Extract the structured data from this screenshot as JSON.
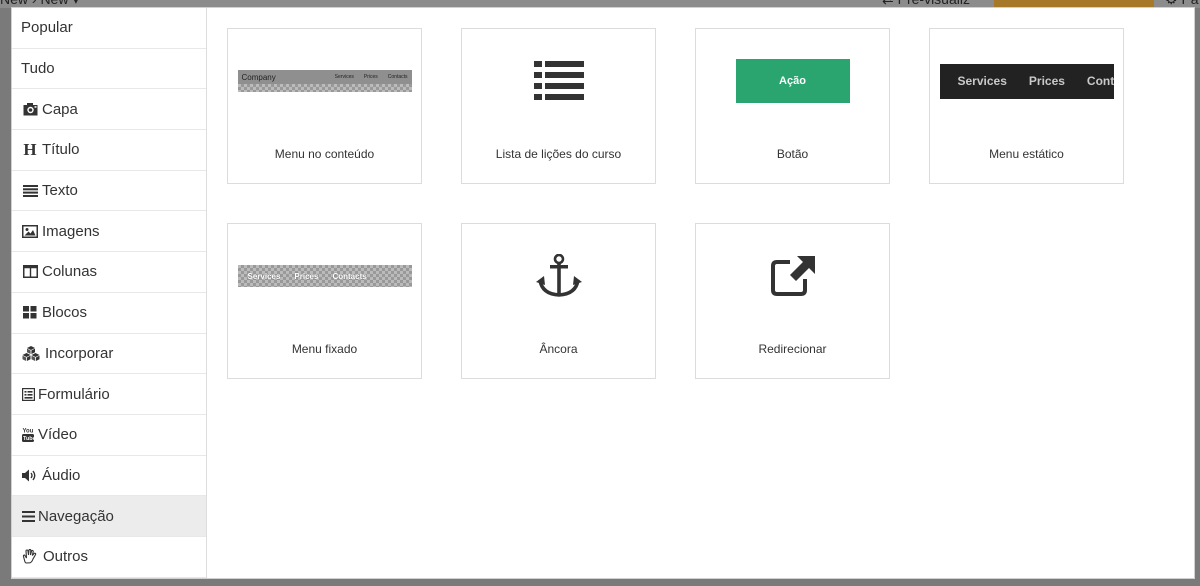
{
  "background": {
    "left_text": "New   › New ▾",
    "right_text": "⇄ Pré-visualiz",
    "far_right_text": "⚙ Pa",
    "accent_color": "#a67829"
  },
  "sidebar": {
    "items": [
      {
        "label": "Popular",
        "icon": ""
      },
      {
        "label": "Tudo",
        "icon": ""
      },
      {
        "label": "Capa",
        "icon": "camera-icon"
      },
      {
        "label": "Título",
        "icon": "heading-icon"
      },
      {
        "label": "Texto",
        "icon": "align-justify-icon"
      },
      {
        "label": "Imagens",
        "icon": "image-icon"
      },
      {
        "label": "Colunas",
        "icon": "columns-icon"
      },
      {
        "label": "Blocos",
        "icon": "th-large-icon"
      },
      {
        "label": "Incorporar",
        "icon": "cubes-icon"
      },
      {
        "label": "Formulário",
        "icon": "form-icon"
      },
      {
        "label": "Vídeo",
        "icon": "youtube-icon"
      },
      {
        "label": "Áudio",
        "icon": "volume-icon"
      },
      {
        "label": "Navegação",
        "icon": "bars-icon"
      },
      {
        "label": "Outros",
        "icon": "hand-icon"
      }
    ],
    "active": "Navegação"
  },
  "blocks": [
    {
      "label": "Menu no conteúdo",
      "preview": {
        "brand": "Company",
        "links": [
          "Services",
          "Prices",
          "Contacts"
        ]
      }
    },
    {
      "label": "Lista de lições do curso",
      "preview": {
        "icon": "list-icon"
      }
    },
    {
      "label": "Botão",
      "preview": {
        "button_text": "Ação",
        "color": "#2aa56f"
      }
    },
    {
      "label": "Menu estático",
      "preview": {
        "links": [
          "Services",
          "Prices",
          "Conta"
        ]
      }
    },
    {
      "label": "Menu fixado",
      "preview": {
        "links": [
          "Services",
          "Prices",
          "Contacts"
        ]
      }
    },
    {
      "label": "Âncora",
      "preview": {
        "icon": "anchor-icon"
      }
    },
    {
      "label": "Redirecionar",
      "preview": {
        "icon": "external-link-icon"
      }
    }
  ]
}
